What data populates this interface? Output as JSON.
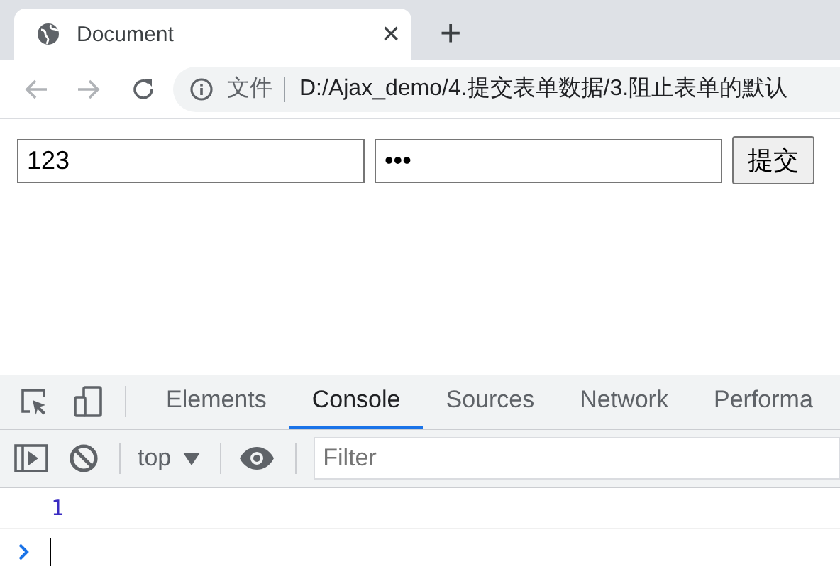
{
  "browser_tab": {
    "title": "Document",
    "close": "×"
  },
  "new_tab": "+",
  "address_bar": {
    "security_label": "文件",
    "url": "D:/Ajax_demo/4.提交表单数据/3.阻止表单的默认"
  },
  "form": {
    "username": {
      "value": "123"
    },
    "password": {
      "value": "•••"
    },
    "submit": "提交"
  },
  "devtools": {
    "tabs": [
      {
        "label": "Elements",
        "selected": false
      },
      {
        "label": "Console",
        "selected": true
      },
      {
        "label": "Sources",
        "selected": false
      },
      {
        "label": "Network",
        "selected": false
      },
      {
        "label": "Performa",
        "selected": false
      }
    ],
    "context": "top",
    "filter": {
      "placeholder": "Filter"
    },
    "log": [
      {
        "text": "1"
      }
    ]
  }
}
